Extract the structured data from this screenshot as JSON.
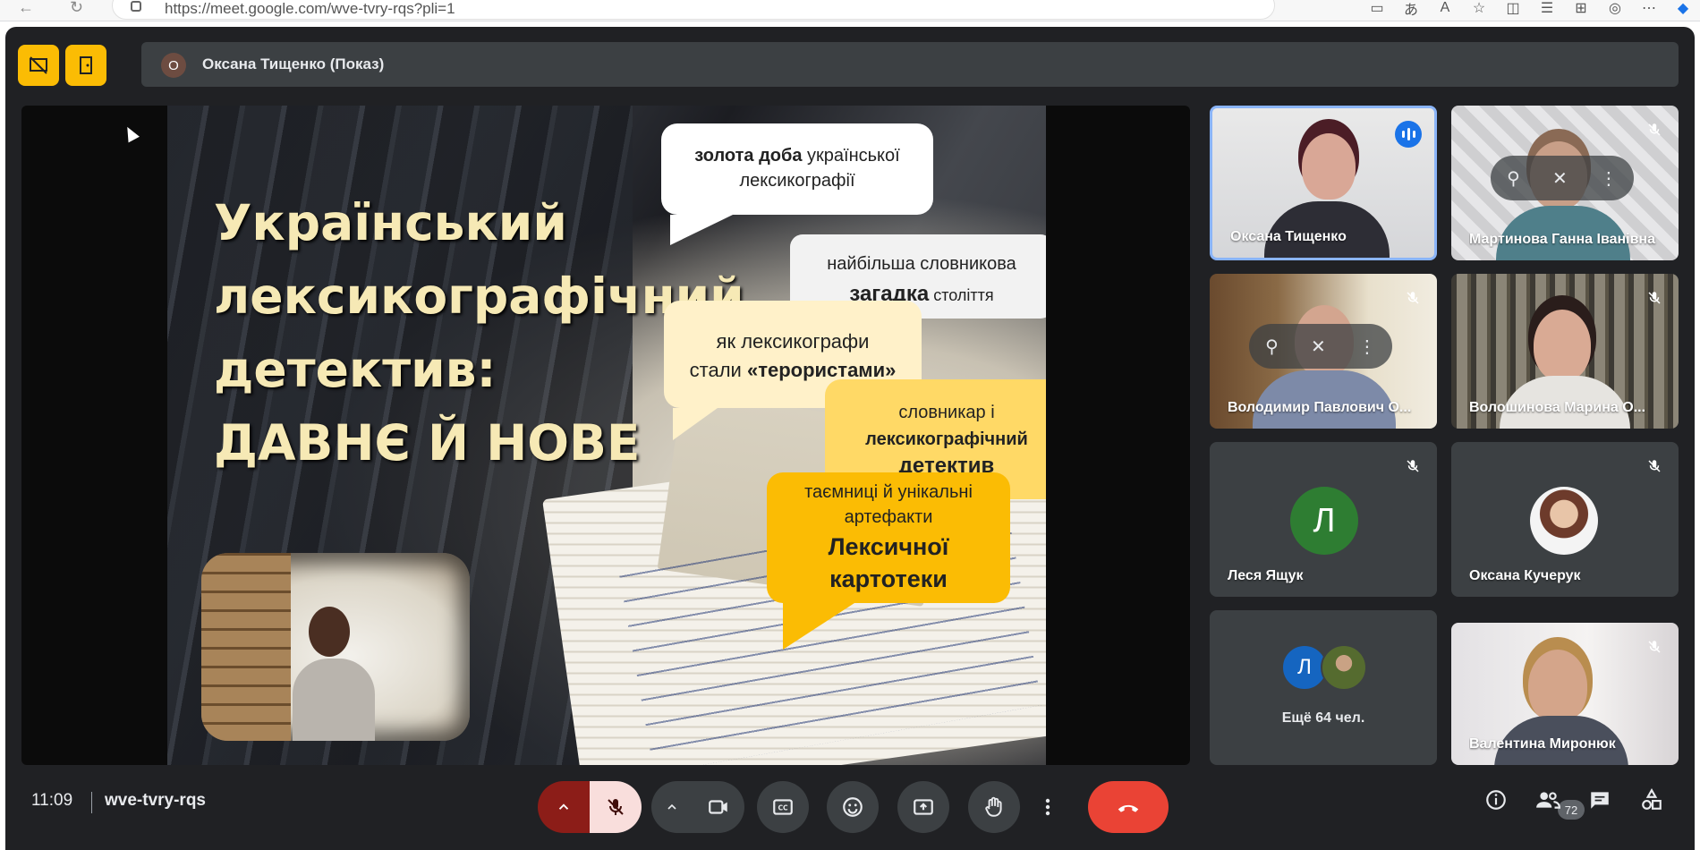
{
  "browser": {
    "url": "https://meet.google.com/wve-tvry-rqs?pli=1"
  },
  "presenter": {
    "avatar_letter": "О",
    "label": "Оксана Тищенко (Показ)"
  },
  "slide": {
    "title": "Український\nлексикографічний\nдетектив:\nДАВНЄ Й НОВЕ",
    "bubble1_bold": "золота доба",
    "bubble1_rest": " української лексикографії",
    "bubble2_line1": "найбільша словникова",
    "bubble2_bold": "загадка",
    "bubble2_rest": " століття",
    "bubble3_line1": "як лексикографи",
    "bubble3_line2a": "стали ",
    "bubble3_bold": "«терористами»",
    "bubble4_line1": "словникар   і",
    "bubble4_bold1": "лексикографічний",
    "bubble4_bold2": "детектив",
    "bubble5_line1": "таємниці й унікальні",
    "bubble5_line2": "артефакти",
    "bubble5_bold1": "Лексичної",
    "bubble5_bold2": "картотеки"
  },
  "participants": [
    {
      "name": "Оксана Тищенко",
      "speaking": true
    },
    {
      "name": "Мартинова Ганна Іванівна",
      "muted": true
    },
    {
      "name": "Володимир Павлович О...",
      "muted": true
    },
    {
      "name": "Волошинова Марина О...",
      "muted": true
    },
    {
      "name": "Леся Ящук",
      "avatar_letter": "Л",
      "avatar_color": "#2e7d32",
      "muted": true
    },
    {
      "name": "Оксана Кучерук",
      "muted": true
    },
    {
      "name": "Валентина Миронюк",
      "muted": true
    }
  ],
  "more": {
    "avatar_letter": "Л",
    "label": "Ещё 64 чел."
  },
  "bottom": {
    "time": "11:09",
    "meeting_code": "wve-tvry-rqs",
    "people_count": "72"
  },
  "colors": {
    "accent_yellow": "#fbbc04",
    "hangup_red": "#ea4335",
    "active_border": "#8ab4f8",
    "background": "#202124"
  }
}
